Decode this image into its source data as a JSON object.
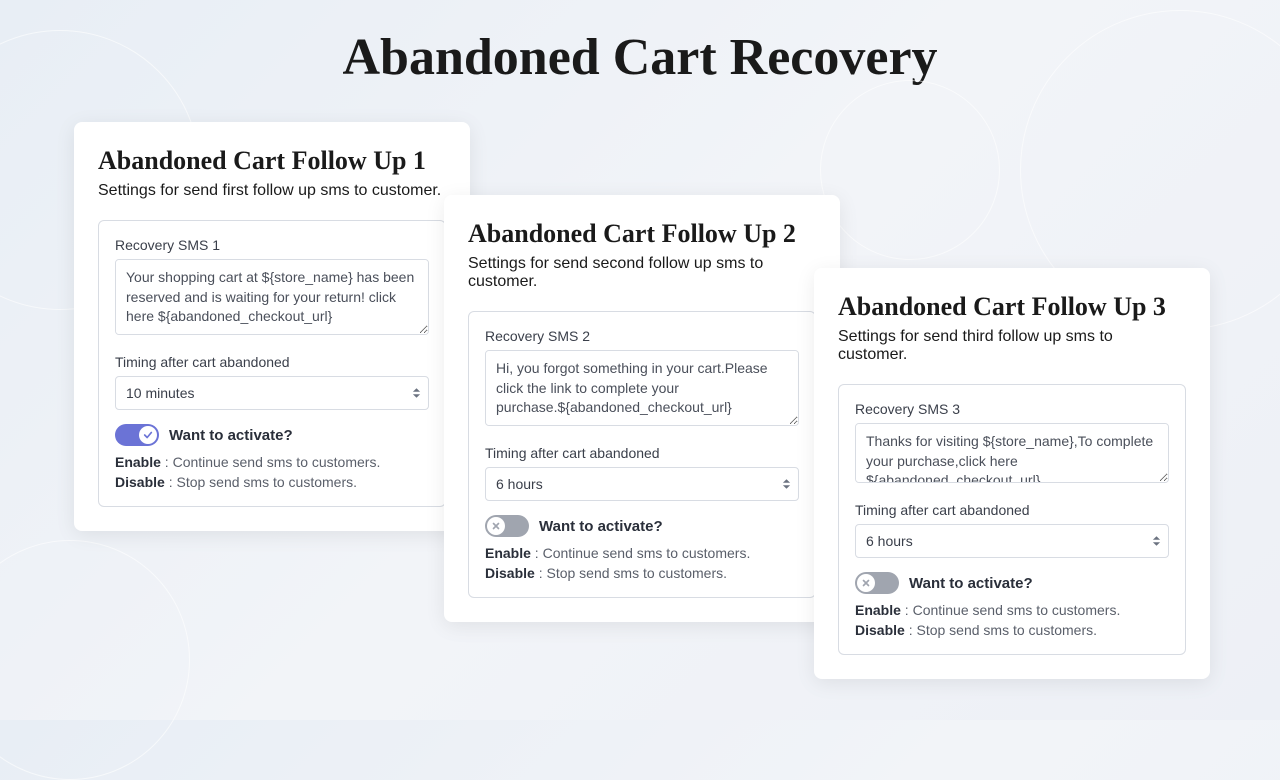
{
  "page_title": "Abandoned Cart Recovery",
  "cards": [
    {
      "title": "Abandoned Cart Follow Up 1",
      "subtitle": "Settings for send first follow up sms to customer.",
      "sms_label": "Recovery SMS 1",
      "sms_text": "Your shopping cart at ${store_name} has been reserved and is waiting for your return! click here ${abandoned_checkout_url}",
      "timing_label": "Timing after cart abandoned",
      "timing_value": "10 minutes",
      "activate_label": "Want to activate?",
      "toggle_state": "on",
      "enable_label": "Enable",
      "enable_text": "Continue send sms to customers.",
      "disable_label": "Disable",
      "disable_text": "Stop send sms to customers."
    },
    {
      "title": "Abandoned Cart Follow Up 2",
      "subtitle": "Settings for send second follow up sms to customer.",
      "sms_label": "Recovery SMS 2",
      "sms_text": "Hi, you forgot something in your cart.Please click the link to complete your purchase.${abandoned_checkout_url}",
      "timing_label": "Timing after cart abandoned",
      "timing_value": "6 hours",
      "activate_label": "Want to activate?",
      "toggle_state": "off",
      "enable_label": "Enable",
      "enable_text": "Continue send sms to customers.",
      "disable_label": "Disable",
      "disable_text": "Stop send sms to customers."
    },
    {
      "title": "Abandoned Cart Follow Up 3",
      "subtitle": "Settings for send third follow up sms to customer.",
      "sms_label": "Recovery SMS 3",
      "sms_text": "Thanks for visiting ${store_name},To complete your purchase,click here ${abandoned_checkout_url}",
      "timing_label": "Timing after cart abandoned",
      "timing_value": "6 hours",
      "activate_label": "Want to activate?",
      "toggle_state": "off",
      "enable_label": "Enable",
      "enable_text": "Continue send sms to customers.",
      "disable_label": "Disable",
      "disable_text": "Stop send sms to customers."
    }
  ]
}
